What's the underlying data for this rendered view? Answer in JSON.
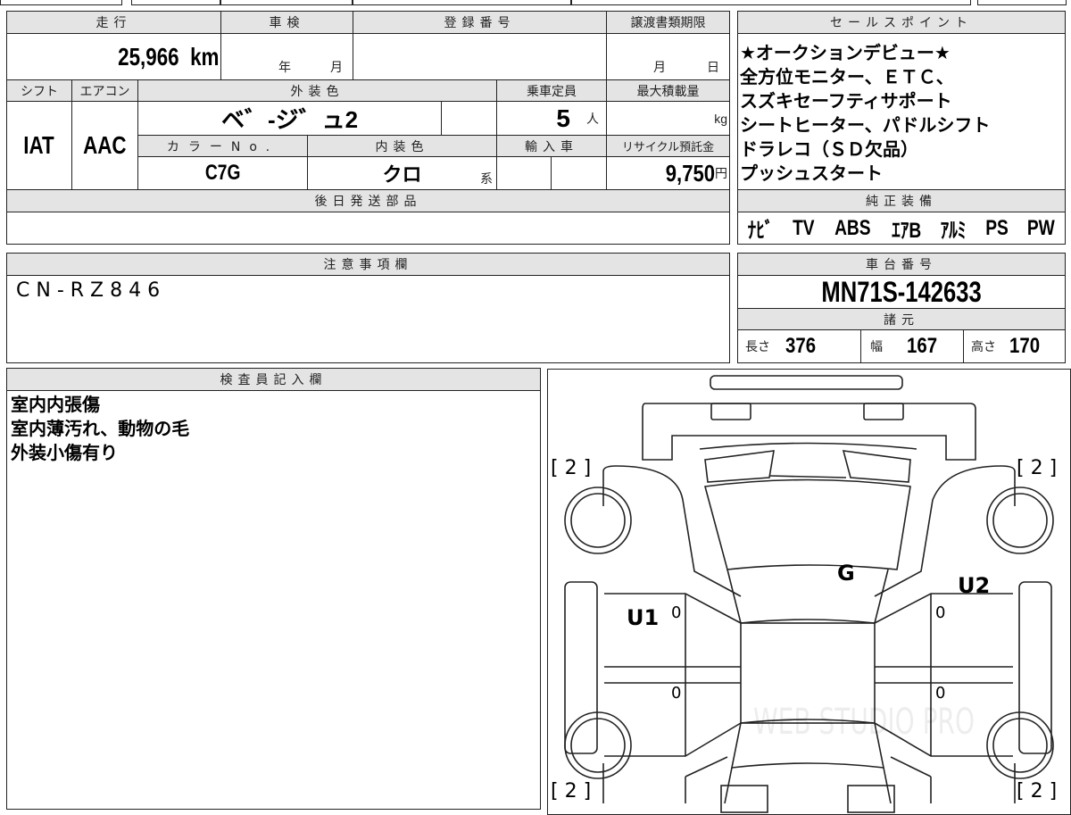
{
  "mileage": {
    "label": "走行",
    "value": "25,966",
    "unit": "km"
  },
  "inspection": {
    "label": "車検",
    "year": "年",
    "month": "月"
  },
  "registration": {
    "label": "登録番号",
    "value": ""
  },
  "transfer_deadline": {
    "label": "譲渡書類期限",
    "month": "月",
    "day": "日"
  },
  "shift": {
    "label": "シフト",
    "value": "IAT"
  },
  "aircon": {
    "label": "エアコン",
    "value": "AAC"
  },
  "exterior_color": {
    "label": "外装色",
    "value": "ベ゛-ジ゛ュ2"
  },
  "capacity": {
    "label": "乗車定員",
    "value": "5",
    "unit": "人"
  },
  "max_load": {
    "label": "最大積載量",
    "unit": "kg"
  },
  "color_no": {
    "label": "カラーNo.",
    "value": "C7G"
  },
  "interior_color": {
    "label": "内装色",
    "value": "クロ",
    "suffix": "系"
  },
  "imported": {
    "label": "輸入車"
  },
  "recycle": {
    "label": "リサイクル預託金",
    "value": "9,750",
    "unit": "円"
  },
  "later_parts": {
    "label": "後日発送部品"
  },
  "sales_points": {
    "label": "セールスポイント",
    "lines": [
      "★オークションデビュー★",
      "全方位モニター、ＥＴＣ、",
      "スズキセーフティサポート",
      "シートヒーター、パドルシフト",
      "ドラレコ（ＳＤ欠品）",
      "プッシュスタート"
    ]
  },
  "equipment": {
    "label": "純正装備",
    "items": [
      "ﾅﾋﾞ",
      "TV",
      "ABS",
      "ｴｱB",
      "ｱﾙﾐ",
      "PS",
      "PW"
    ]
  },
  "notes": {
    "label": "注意事項欄",
    "value": "CN-RZ846"
  },
  "chassis": {
    "label": "車台番号",
    "value": "MN71S-142633"
  },
  "specs": {
    "label": "諸元",
    "length_label": "長さ",
    "length": "376",
    "width_label": "幅",
    "width": "167",
    "height_label": "高さ",
    "height": "170"
  },
  "inspector": {
    "label": "検査員記入欄",
    "lines": [
      "室内内張傷",
      "室内薄汚れ、動物の毛",
      "外装小傷有り"
    ]
  },
  "diagram": {
    "tire_marks": [
      "[ 2 ]",
      "[ 2 ]",
      "[ 2 ]",
      "[ 2 ]"
    ],
    "marks": {
      "g": "G",
      "u1": "U1",
      "u2": "U2",
      "zero": "0"
    },
    "watermark": "WEB STUDIO PRO"
  }
}
